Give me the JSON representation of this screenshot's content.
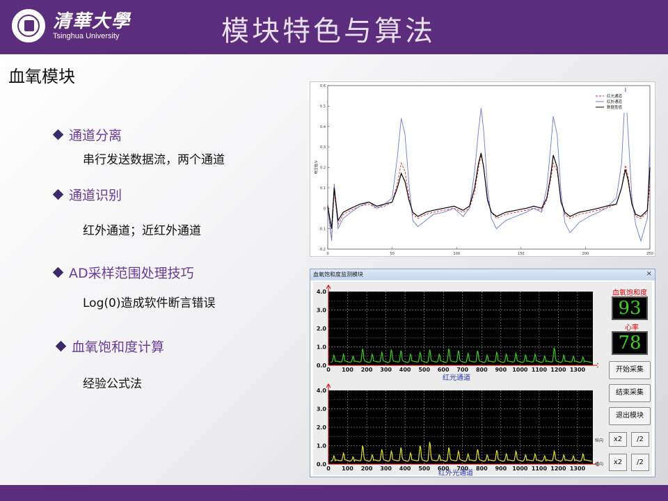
{
  "header": {
    "logo_cn": "清華大學",
    "logo_en": "Tsinghua University",
    "title": "模块特色与算法"
  },
  "section_title": "血氧模块",
  "bullets": [
    {
      "label": "通道分离",
      "detail": "串行发送数据流，两个通道"
    },
    {
      "label": "通道识别",
      "detail": "红外通道；近红外通道"
    },
    {
      "label": "AD采样范围处理技巧",
      "detail": "Log(0)造成软件断言错误"
    },
    {
      "label": "血氧饱和度计算",
      "detail": "经验公式法"
    }
  ],
  "chart_data": [
    {
      "type": "line",
      "ylabel": "电压值/V",
      "xlim": [
        0,
        250
      ],
      "ylim": [
        -0.2,
        0.6
      ],
      "xticks": [
        "0",
        "50",
        "100",
        "150",
        "200",
        "250"
      ],
      "yticks": [
        "-0.2",
        "-0.1",
        "0",
        "0.1",
        "0.2",
        "0.3",
        "0.4",
        "0.5",
        "0.6"
      ],
      "legend_position": "top-right",
      "series": [
        {
          "name": "红光通道",
          "color": "#e02020",
          "style": "dashed",
          "points": [
            [
              0,
              0.02
            ],
            [
              3,
              -0.15
            ],
            [
              5,
              0.08
            ],
            [
              8,
              -0.08
            ],
            [
              12,
              -0.03
            ],
            [
              18,
              -0.01
            ],
            [
              25,
              0.01
            ],
            [
              32,
              0.02
            ],
            [
              38,
              0.0
            ],
            [
              44,
              0.01
            ],
            [
              50,
              0.03
            ],
            [
              54,
              0.12
            ],
            [
              57,
              0.22
            ],
            [
              60,
              0.18
            ],
            [
              63,
              0.06
            ],
            [
              66,
              -0.03
            ],
            [
              70,
              -0.05
            ],
            [
              76,
              -0.03
            ],
            [
              82,
              -0.02
            ],
            [
              90,
              -0.01
            ],
            [
              98,
              0.0
            ],
            [
              105,
              -0.02
            ],
            [
              110,
              0.0
            ],
            [
              114,
              0.08
            ],
            [
              117,
              0.2
            ],
            [
              119,
              0.26
            ],
            [
              121,
              0.2
            ],
            [
              124,
              0.05
            ],
            [
              127,
              -0.02
            ],
            [
              131,
              -0.05
            ],
            [
              138,
              -0.03
            ],
            [
              146,
              -0.02
            ],
            [
              154,
              -0.01
            ],
            [
              160,
              0.0
            ],
            [
              166,
              -0.01
            ],
            [
              170,
              0.04
            ],
            [
              173,
              0.14
            ],
            [
              175,
              0.22
            ],
            [
              178,
              0.18
            ],
            [
              181,
              0.04
            ],
            [
              184,
              -0.03
            ],
            [
              188,
              -0.05
            ],
            [
              195,
              -0.03
            ],
            [
              203,
              -0.02
            ],
            [
              210,
              -0.01
            ],
            [
              216,
              0.0
            ],
            [
              224,
              0.02
            ],
            [
              228,
              0.1
            ],
            [
              231,
              0.21
            ],
            [
              233,
              0.16
            ],
            [
              236,
              0.02
            ],
            [
              239,
              -0.04
            ],
            [
              243,
              -0.05
            ],
            [
              248,
              -0.02
            ],
            [
              250,
              0.12
            ]
          ]
        },
        {
          "name": "红外通道",
          "color": "#6a78d8",
          "style": "solid",
          "points": [
            [
              0,
              0.0
            ],
            [
              3,
              -0.16
            ],
            [
              5,
              0.12
            ],
            [
              8,
              -0.1
            ],
            [
              12,
              -0.05
            ],
            [
              18,
              -0.02
            ],
            [
              25,
              0.01
            ],
            [
              32,
              0.03
            ],
            [
              38,
              0.0
            ],
            [
              44,
              0.02
            ],
            [
              50,
              0.05
            ],
            [
              54,
              0.25
            ],
            [
              57,
              0.44
            ],
            [
              60,
              0.36
            ],
            [
              63,
              0.12
            ],
            [
              66,
              -0.06
            ],
            [
              70,
              -0.09
            ],
            [
              76,
              -0.06
            ],
            [
              82,
              -0.03
            ],
            [
              90,
              -0.02
            ],
            [
              98,
              0.0
            ],
            [
              105,
              -0.04
            ],
            [
              110,
              0.0
            ],
            [
              114,
              0.18
            ],
            [
              117,
              0.38
            ],
            [
              119,
              0.49
            ],
            [
              121,
              0.38
            ],
            [
              124,
              0.1
            ],
            [
              127,
              -0.05
            ],
            [
              131,
              -0.1
            ],
            [
              138,
              -0.06
            ],
            [
              146,
              -0.04
            ],
            [
              154,
              -0.02
            ],
            [
              160,
              0.0
            ],
            [
              166,
              -0.02
            ],
            [
              170,
              0.1
            ],
            [
              173,
              0.3
            ],
            [
              175,
              0.45
            ],
            [
              178,
              0.36
            ],
            [
              181,
              0.08
            ],
            [
              184,
              -0.07
            ],
            [
              188,
              -0.12
            ],
            [
              195,
              -0.07
            ],
            [
              203,
              -0.04
            ],
            [
              210,
              -0.02
            ],
            [
              216,
              0.0
            ],
            [
              224,
              0.05
            ],
            [
              228,
              0.22
            ],
            [
              231,
              0.59
            ],
            [
              233,
              0.38
            ],
            [
              236,
              0.05
            ],
            [
              239,
              -0.08
            ],
            [
              243,
              -0.16
            ],
            [
              248,
              -0.05
            ],
            [
              250,
              0.33
            ]
          ]
        },
        {
          "name": "数据差值",
          "color": "#000000",
          "style": "solid",
          "points": [
            [
              0,
              0.01
            ],
            [
              3,
              -0.1
            ],
            [
              5,
              0.1
            ],
            [
              8,
              -0.06
            ],
            [
              12,
              -0.02
            ],
            [
              18,
              0.0
            ],
            [
              25,
              0.02
            ],
            [
              32,
              0.03
            ],
            [
              38,
              0.01
            ],
            [
              44,
              0.02
            ],
            [
              50,
              0.03
            ],
            [
              54,
              0.1
            ],
            [
              57,
              0.17
            ],
            [
              60,
              0.13
            ],
            [
              63,
              0.04
            ],
            [
              66,
              -0.02
            ],
            [
              70,
              -0.04
            ],
            [
              76,
              -0.02
            ],
            [
              82,
              -0.01
            ],
            [
              90,
              0.0
            ],
            [
              98,
              0.01
            ],
            [
              105,
              -0.01
            ],
            [
              110,
              0.01
            ],
            [
              114,
              0.1
            ],
            [
              117,
              0.22
            ],
            [
              119,
              0.27
            ],
            [
              121,
              0.2
            ],
            [
              124,
              0.04
            ],
            [
              127,
              -0.02
            ],
            [
              131,
              -0.04
            ],
            [
              138,
              -0.02
            ],
            [
              146,
              -0.01
            ],
            [
              154,
              0.0
            ],
            [
              160,
              0.01
            ],
            [
              166,
              0.0
            ],
            [
              170,
              0.05
            ],
            [
              173,
              0.16
            ],
            [
              175,
              0.26
            ],
            [
              178,
              0.2
            ],
            [
              181,
              0.03
            ],
            [
              184,
              -0.02
            ],
            [
              188,
              -0.04
            ],
            [
              195,
              -0.02
            ],
            [
              203,
              -0.01
            ],
            [
              210,
              0.0
            ],
            [
              216,
              0.01
            ],
            [
              224,
              0.02
            ],
            [
              228,
              0.1
            ],
            [
              231,
              0.19
            ],
            [
              233,
              0.14
            ],
            [
              236,
              0.02
            ],
            [
              239,
              -0.03
            ],
            [
              243,
              -0.04
            ],
            [
              248,
              -0.01
            ],
            [
              250,
              0.2
            ]
          ]
        }
      ]
    },
    {
      "type": "line",
      "xlabel": "红光通道",
      "xlim": [
        0,
        1380
      ],
      "ylim": [
        0,
        4.0
      ],
      "xticks": [
        "0",
        "100",
        "200",
        "300",
        "400",
        "500",
        "600",
        "700",
        "800",
        "900",
        "1000",
        "1100",
        "1200",
        "1300"
      ],
      "yticks": [
        "0.0",
        "1.0",
        "2.0",
        "3.0",
        "4.0"
      ],
      "grid": true,
      "series": [
        {
          "color": "#36d216",
          "peaks": [
            [
              30,
              0.55
            ],
            [
              80,
              0.6
            ],
            [
              130,
              0.5
            ],
            [
              180,
              0.9
            ],
            [
              230,
              0.6
            ],
            [
              280,
              0.7
            ],
            [
              330,
              0.85
            ],
            [
              380,
              0.8
            ],
            [
              430,
              0.6
            ],
            [
              480,
              0.7
            ],
            [
              530,
              0.85
            ],
            [
              580,
              0.6
            ],
            [
              630,
              0.9
            ],
            [
              680,
              0.8
            ],
            [
              730,
              0.65
            ],
            [
              780,
              0.8
            ],
            [
              830,
              0.55
            ],
            [
              880,
              0.7
            ],
            [
              930,
              0.6
            ],
            [
              980,
              0.65
            ],
            [
              1030,
              0.55
            ],
            [
              1080,
              0.6
            ],
            [
              1130,
              0.5
            ],
            [
              1180,
              0.95
            ],
            [
              1230,
              0.55
            ],
            [
              1280,
              0.5
            ],
            [
              1330,
              0.45
            ]
          ]
        }
      ]
    },
    {
      "type": "line",
      "xlabel": "红外光通道",
      "xlim": [
        0,
        1380
      ],
      "ylim": [
        0,
        4.0
      ],
      "xticks": [
        "0",
        "100",
        "200",
        "300",
        "400",
        "500",
        "600",
        "700",
        "800",
        "900",
        "1000",
        "1100",
        "1200",
        "1300"
      ],
      "yticks": [
        "0.0",
        "1.0",
        "2.0",
        "3.0",
        "4.0"
      ],
      "grid": true,
      "series": [
        {
          "color": "#e8e620",
          "peaks": [
            [
              30,
              0.45
            ],
            [
              80,
              0.6
            ],
            [
              130,
              0.4
            ],
            [
              180,
              1.0
            ],
            [
              230,
              0.5
            ],
            [
              280,
              0.8
            ],
            [
              330,
              0.7
            ],
            [
              380,
              0.9
            ],
            [
              430,
              0.6
            ],
            [
              480,
              1.0
            ],
            [
              530,
              1.2
            ],
            [
              580,
              0.5
            ],
            [
              630,
              0.9
            ],
            [
              680,
              0.7
            ],
            [
              730,
              0.55
            ],
            [
              780,
              0.8
            ],
            [
              830,
              0.5
            ],
            [
              880,
              0.75
            ],
            [
              930,
              0.55
            ],
            [
              980,
              0.7
            ],
            [
              1030,
              0.5
            ],
            [
              1080,
              0.55
            ],
            [
              1130,
              0.45
            ],
            [
              1180,
              0.7
            ],
            [
              1230,
              0.5
            ],
            [
              1280,
              0.45
            ],
            [
              1330,
              0.55
            ]
          ]
        }
      ]
    }
  ],
  "window": {
    "title": "血氧饱和度监测模块",
    "close": "×",
    "spo2_label": "血氧饱和度",
    "spo2_value": "93",
    "hr_label": "心率",
    "hr_value": "78",
    "buttons": {
      "start": "开始采集",
      "stop": "结束采集",
      "exit": "退出模块"
    },
    "vertical_label": "纵向",
    "horizontal_label": "横向",
    "zoom_in": "x2",
    "zoom_out": "/2"
  }
}
